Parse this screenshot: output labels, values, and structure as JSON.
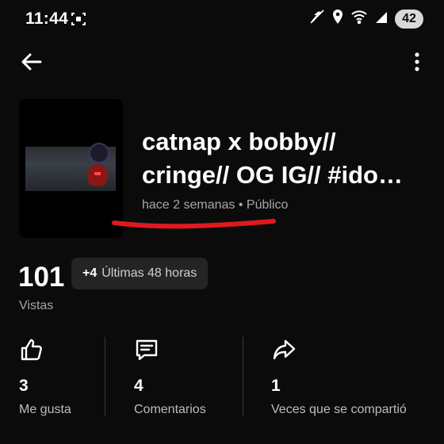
{
  "status_bar": {
    "time": "11:44",
    "battery": "42"
  },
  "video": {
    "title_line1": "catnap x bobby//",
    "title_line2": "cringe// OG IG// #ido…",
    "meta": "hace 2 semanas • Público"
  },
  "views": {
    "count": "101",
    "delta": "+4",
    "period": "Últimas 48 horas",
    "label": "Vistas"
  },
  "stats": [
    {
      "count": "3",
      "label": "Me gusta",
      "icon": "thumbs-up-icon"
    },
    {
      "count": "4",
      "label": "Comentarios",
      "icon": "comment-icon"
    },
    {
      "count": "1",
      "label": "Veces que se compartió",
      "icon": "share-icon"
    }
  ],
  "colors": {
    "background": "#0b0b0c",
    "accent_mark": "#e0191f",
    "muted_text": "#a7a7a7"
  }
}
